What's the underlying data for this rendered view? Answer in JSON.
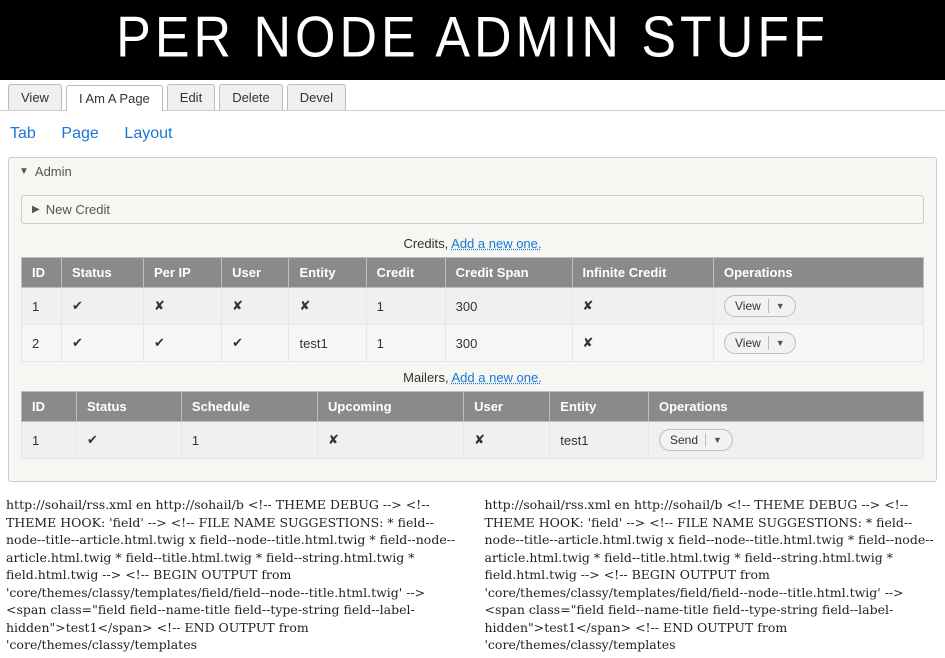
{
  "header": {
    "title": "PER NODE ADMIN STUFF"
  },
  "primary_tabs": [
    {
      "label": "View"
    },
    {
      "label": "I Am A Page",
      "active": true
    },
    {
      "label": "Edit"
    },
    {
      "label": "Delete"
    },
    {
      "label": "Devel"
    }
  ],
  "sub_tabs": [
    {
      "label": "Tab"
    },
    {
      "label": "Page"
    },
    {
      "label": "Layout"
    }
  ],
  "admin_panel": {
    "title": "Admin",
    "new_credit_label": "New Credit"
  },
  "credits": {
    "caption_prefix": "Credits, ",
    "caption_link": "Add a new one.",
    "headers": [
      "ID",
      "Status",
      "Per IP",
      "User",
      "Entity",
      "Credit",
      "Credit Span",
      "Infinite Credit",
      "Operations"
    ],
    "rows": [
      {
        "id": "1",
        "status": "✔",
        "per_ip": "✘",
        "user": "✘",
        "entity": "✘",
        "credit": "1",
        "span": "300",
        "infinite": "✘",
        "op": "View"
      },
      {
        "id": "2",
        "status": "✔",
        "per_ip": "✔",
        "user": "✔",
        "entity": "✘",
        "credit": "1",
        "span": "300",
        "infinite": "✘",
        "op": "View"
      }
    ],
    "op_name": "test1"
  },
  "mailers": {
    "caption_prefix": "Mailers, ",
    "caption_link": "Add a new one.",
    "headers": [
      "ID",
      "Status",
      "Schedule",
      "Upcoming",
      "User",
      "Entity",
      "Operations"
    ],
    "rows": [
      {
        "id": "1",
        "status": "✔",
        "schedule": "1",
        "upcoming": "✘",
        "user": "✘",
        "entity": "test1",
        "op": "Send"
      }
    ]
  },
  "debug": {
    "text": "http://sohail/rss.xml en http://sohail/b <!-- THEME DEBUG --> <!-- THEME HOOK: 'field' --> <!-- FILE NAME SUGGESTIONS: * field--node--title--article.html.twig x field--node--title.html.twig * field--node--article.html.twig * field--title.html.twig * field--string.html.twig * field.html.twig --> <!-- BEGIN OUTPUT from 'core/themes/classy/templates/field/field--node--title.html.twig' --> <span class=\"field field--name-title field--type-string field--label-hidden\">test1</span> <!-- END OUTPUT from 'core/themes/classy/templates"
  }
}
